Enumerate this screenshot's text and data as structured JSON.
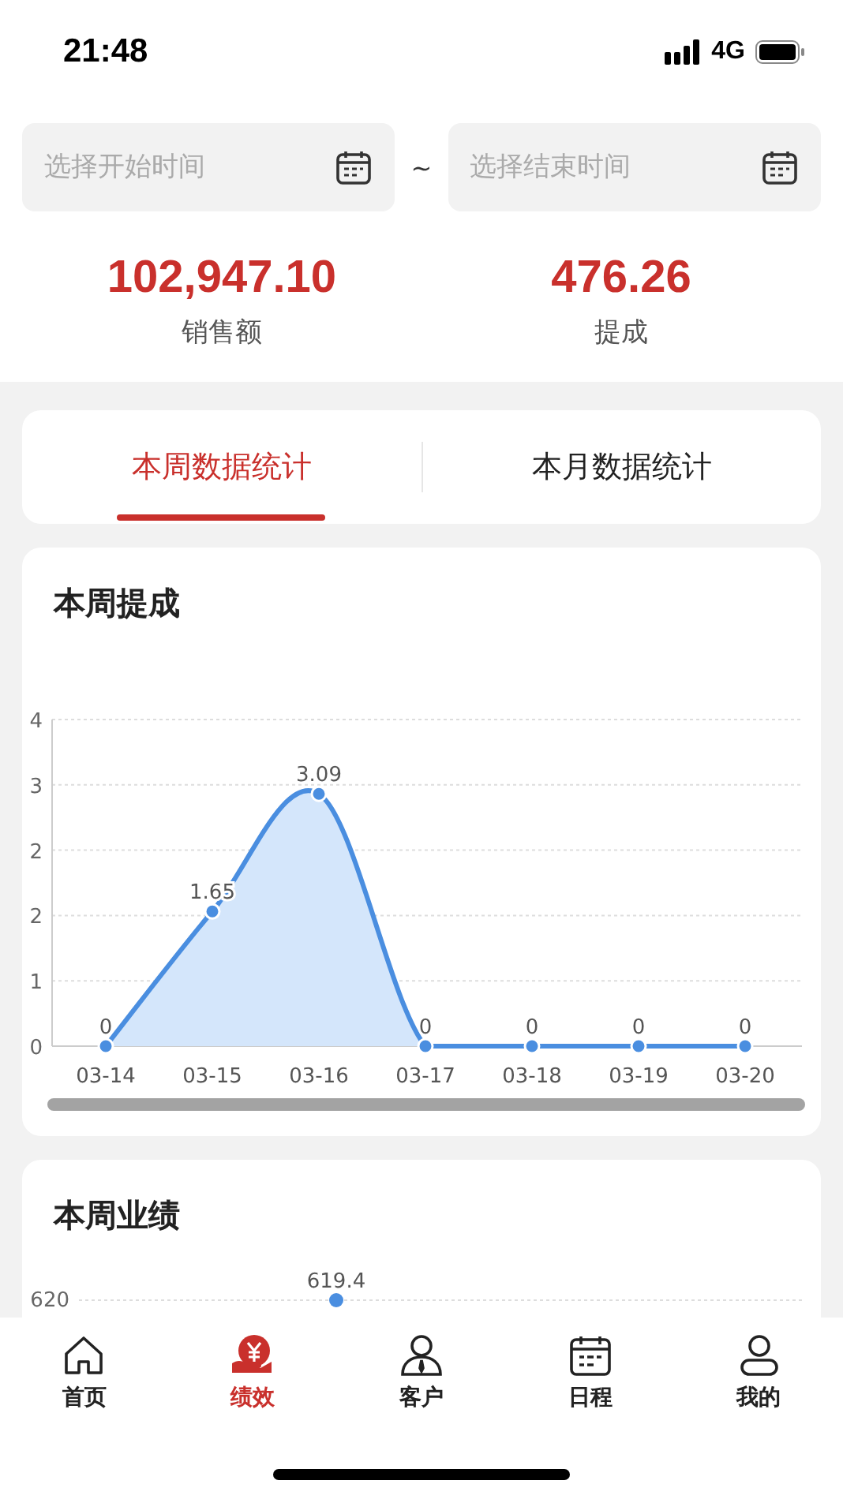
{
  "status_bar": {
    "time": "21:48",
    "network": "4G"
  },
  "date_range": {
    "start": {
      "placeholder": "选择开始时间"
    },
    "separator": "~",
    "end": {
      "placeholder": "选择结束时间"
    }
  },
  "summary": [
    {
      "value": "102,947.10",
      "label": "销售额"
    },
    {
      "value": "476.26",
      "label": "提成"
    }
  ],
  "tabs": [
    {
      "label": "本周数据统计",
      "selected": true
    },
    {
      "label": "本月数据统计",
      "selected": false
    }
  ],
  "commission_card": {
    "title": "本周提成",
    "chart_data": {
      "type": "area",
      "categories": [
        "03-14",
        "03-15",
        "03-16",
        "03-17",
        "03-18",
        "03-19",
        "03-20"
      ],
      "grid": true,
      "series": [
        {
          "color": "#4a8ee0",
          "values": [
            0,
            1.65,
            3.09,
            0,
            0,
            0,
            0
          ]
        }
      ],
      "ylim": [
        0,
        4
      ],
      "yticks": [
        {
          "value": 0,
          "label": "0"
        },
        {
          "value": 0.8,
          "label": "1"
        },
        {
          "value": 1.6,
          "label": "2"
        },
        {
          "value": 2.4,
          "label": "2"
        },
        {
          "value": 3.2,
          "label": "3"
        },
        {
          "value": 4,
          "label": "4"
        }
      ],
      "data_labels": true
    }
  },
  "performance_card": {
    "title": "本周业绩",
    "axis_label": "620",
    "value_label": "619.4"
  },
  "bottom_nav": [
    {
      "label": "首页",
      "selected": false
    },
    {
      "label": "绩效",
      "selected": true
    },
    {
      "label": "客户",
      "selected": false
    },
    {
      "label": "日程",
      "selected": false
    },
    {
      "label": "我的",
      "selected": false
    }
  ]
}
